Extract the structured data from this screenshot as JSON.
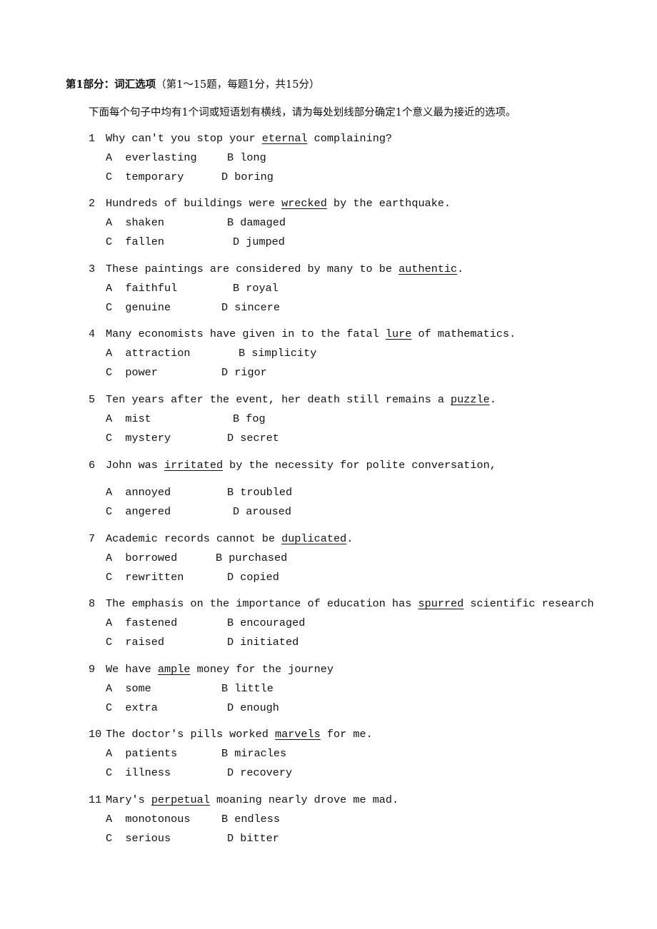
{
  "section": {
    "title_bold": "第1部分：词汇选项",
    "title_note": "（第1～15题，每题1分，共15分）",
    "instruction": "下面每个句子中均有1个词或短语划有横线，请为每处划线部分确定1个意义最为接近的选项。"
  },
  "questions": [
    {
      "number": "1",
      "before": "Why can't you stop your ",
      "underlined": "eternal",
      "after": " complaining?",
      "options": {
        "A": "everlasting",
        "B": "long",
        "C": "temporary",
        "D": "boring"
      }
    },
    {
      "number": "2",
      "before": "Hundreds of buildings were ",
      "underlined": "wrecked",
      "after": " by the earthquake.",
      "options": {
        "A": "shaken",
        "B": "damaged",
        "C": "fallen",
        "D": "jumped"
      }
    },
    {
      "number": "3",
      "before": "These paintings are considered by many to be ",
      "underlined": "authentic",
      "after": ".",
      "options": {
        "A": "faithful",
        "B": "royal",
        "C": "genuine",
        "D": "sincere"
      }
    },
    {
      "number": "4",
      "before": "Many economists have given in to the fatal ",
      "underlined": "lure",
      "after": " of mathematics.",
      "options": {
        "A": "attraction",
        "B": "simplicity",
        "C": "power",
        "D": "rigor"
      }
    },
    {
      "number": "5",
      "before": "Ten years after the event, her death still remains a ",
      "underlined": "puzzle",
      "after": ".",
      "options": {
        "A": "mist",
        "B": "fog",
        "C": "mystery",
        "D": "secret"
      }
    },
    {
      "number": "6",
      "before": "John was ",
      "underlined": "irritated",
      "after": " by the necessity for polite conversation,",
      "options": {
        "A": "annoyed",
        "B": "troubled",
        "C": "angered",
        "D": "aroused"
      }
    },
    {
      "number": "7",
      "before": "Academic records cannot be ",
      "underlined": "duplicated",
      "after": ".",
      "options": {
        "A": "borrowed",
        "B": "purchased",
        "C": "rewritten",
        "D": "copied"
      }
    },
    {
      "number": "8",
      "before": "The emphasis on the importance of education has ",
      "underlined": "spurred",
      "after": " scientific research",
      "options": {
        "A": "fastened",
        "B": "encouraged",
        "C": "raised",
        "D": "initiated"
      }
    },
    {
      "number": "9",
      "before": "We have ",
      "underlined": "ample",
      "after": " money for the journey",
      "options": {
        "A": "some",
        "B": "little",
        "C": "extra",
        "D": "enough"
      }
    },
    {
      "number": "10",
      "before": "The doctor's pills worked ",
      "underlined": "marvels",
      "after": " for me.",
      "options": {
        "A": "patients",
        "B": "miracles",
        "C": "illness",
        "D": "recovery"
      }
    },
    {
      "number": "11",
      "before": "Mary's ",
      "underlined": "perpetual",
      "after": " moaning nearly drove me mad.",
      "options": {
        "A": "monotonous",
        "B": "endless",
        "C": "serious",
        "D": "bitter"
      }
    }
  ]
}
